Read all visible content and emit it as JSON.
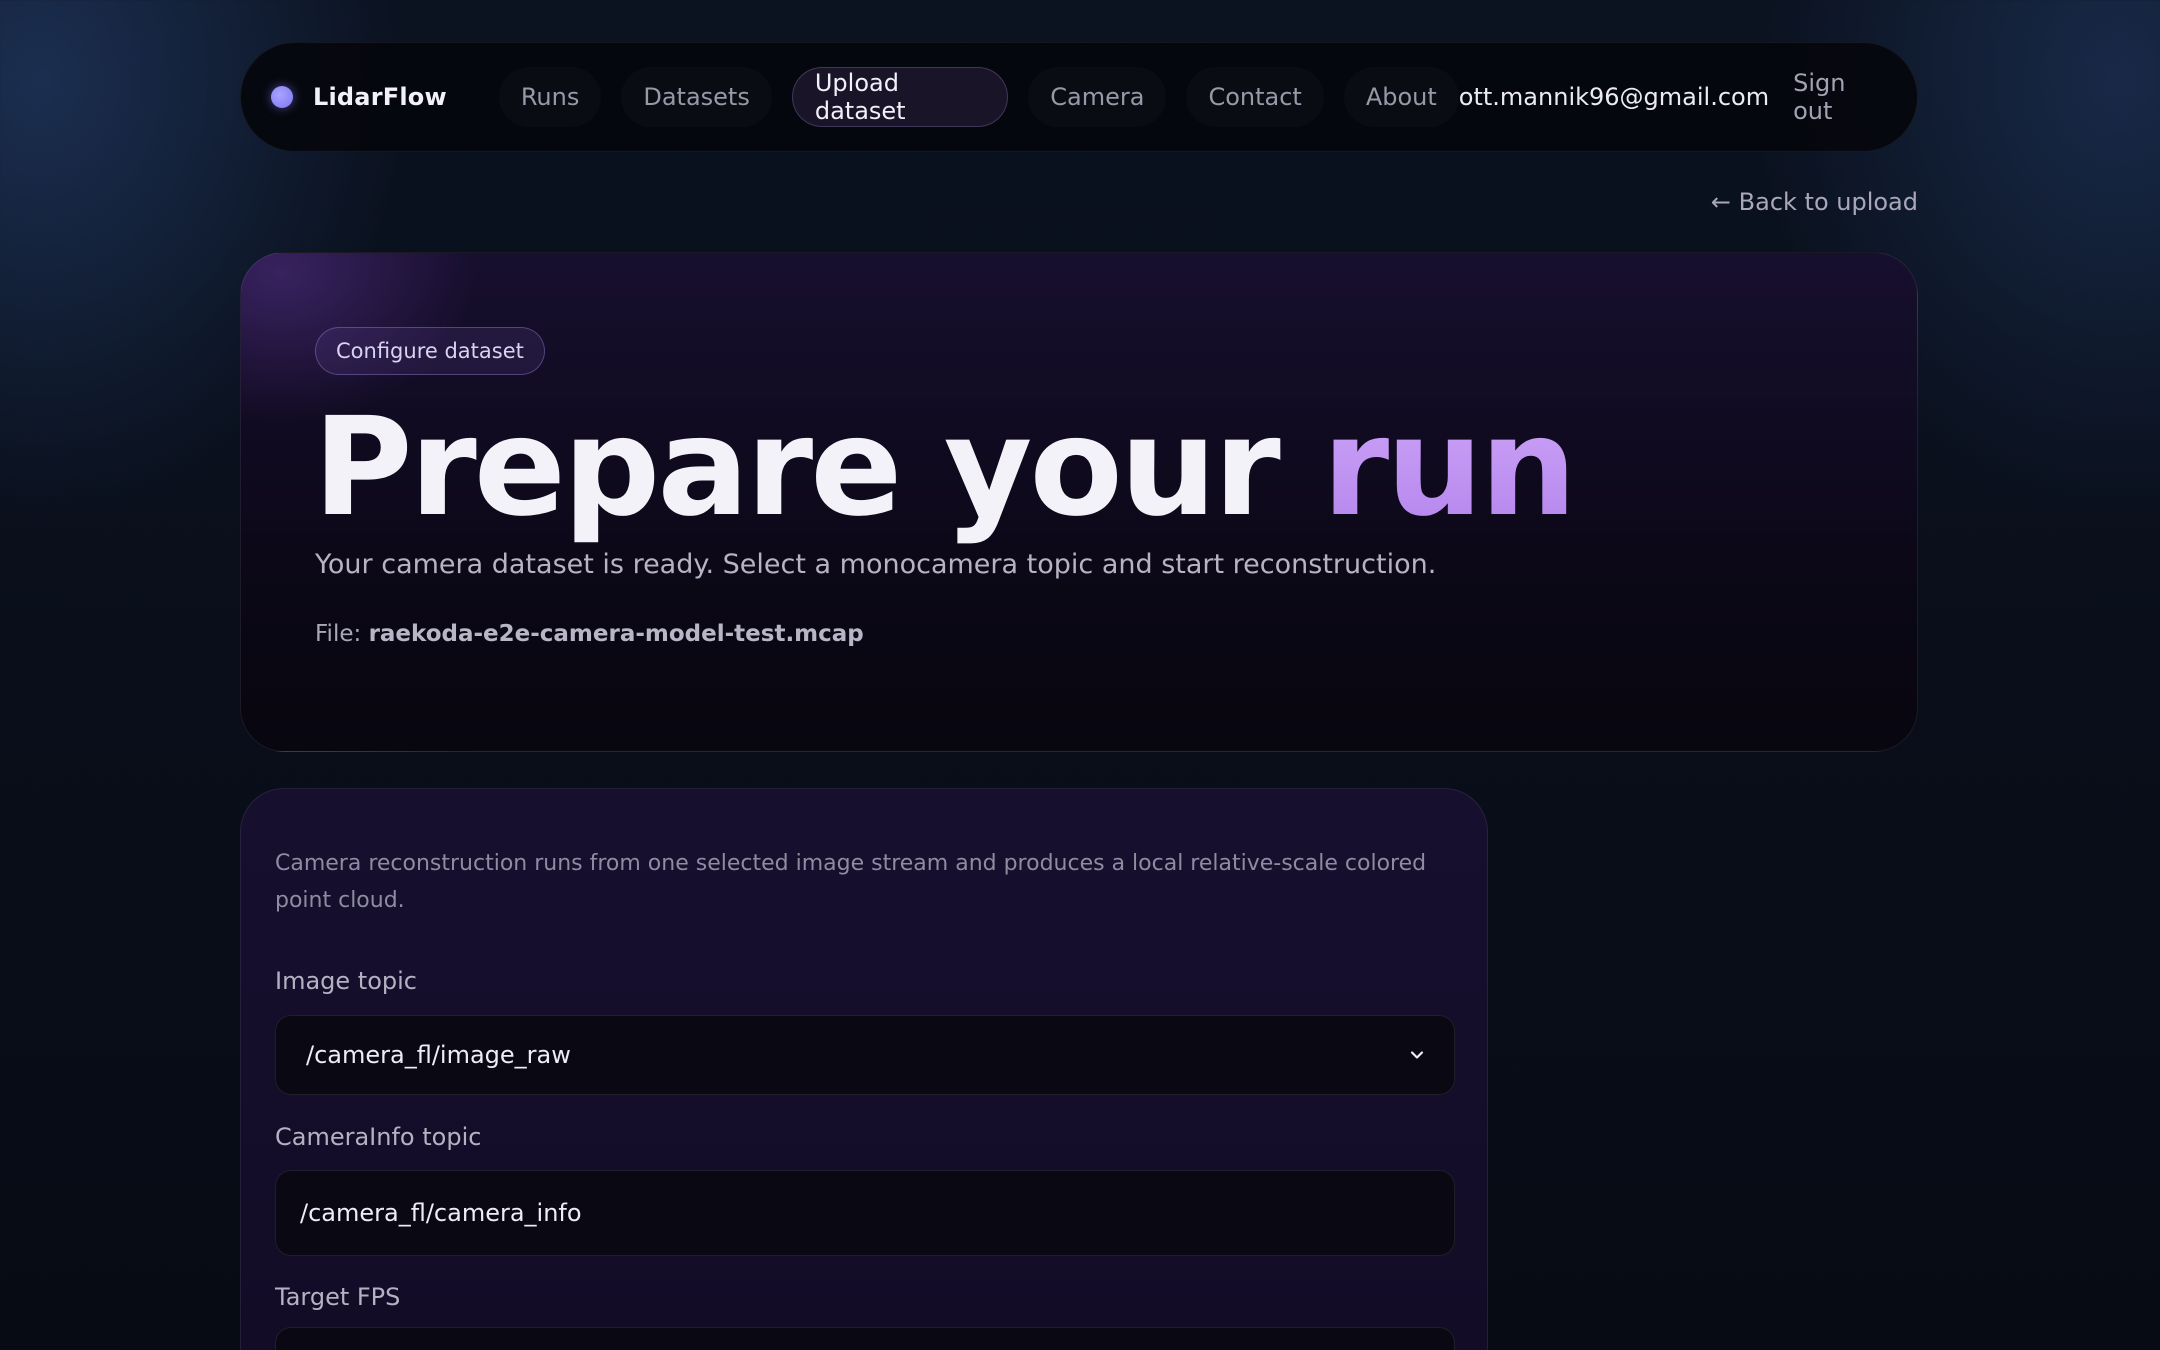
{
  "nav": {
    "brand": "LidarFlow",
    "links": [
      {
        "label": "Runs"
      },
      {
        "label": "Datasets"
      },
      {
        "label": "Upload dataset"
      },
      {
        "label": "Camera"
      },
      {
        "label": "Contact"
      },
      {
        "label": "About"
      }
    ],
    "active_link": "Upload dataset",
    "user_email": "ott.mannik96@gmail.com",
    "sign_out": "Sign out"
  },
  "back_link": "← Back to upload",
  "hero": {
    "badge": "Configure dataset",
    "title_main": "Prepare your",
    "title_accent": "run",
    "subtitle": "Your camera dataset is ready. Select a monocamera topic and start reconstruction.",
    "file_label": "File:",
    "file_name": "raekoda-e2e-camera-model-test.mcap"
  },
  "form": {
    "description": "Camera reconstruction runs from one selected image stream and produces a local relative-scale colored point cloud.",
    "image_topic": {
      "label": "Image topic",
      "value": "/camera_fl/image_raw"
    },
    "camerainfo_topic": {
      "label": "CameraInfo topic",
      "value": "/camera_fl/camera_info"
    },
    "target_fps": {
      "label": "Target FPS"
    }
  },
  "colors": {
    "accent": "#c093f2",
    "brand_dot": "#8f88ff",
    "background": "#070b14"
  },
  "icons": {
    "brand": "brand-dot-icon",
    "select": "chevron-down-icon"
  }
}
